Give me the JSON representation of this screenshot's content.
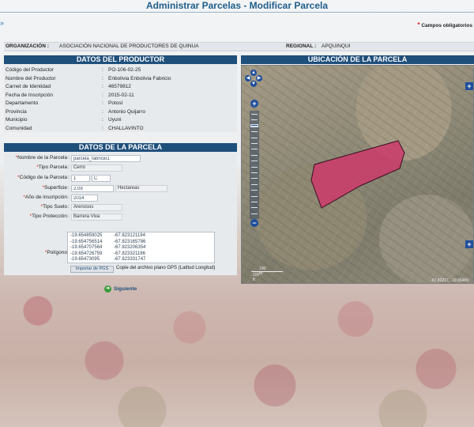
{
  "header": {
    "title": "Administrar Parcelas - Modificar Parcela",
    "required_note": "Campos obligatorios",
    "required_star": "*"
  },
  "org_bar": {
    "org_label": "ORGANIZACIÓN :",
    "org_value": "ASOCIACIÓN NACIONAL DE PRODUCTORES DE QUINUA",
    "regional_label": "REGIONAL :",
    "regional_value": "APQUINQUI"
  },
  "productor": {
    "title": "DATOS DEL PRODUCTOR",
    "rows": [
      {
        "label": "Código del Productor",
        "value": "PO-106-02-25"
      },
      {
        "label": "Nombre del Productor",
        "value": "Enbolivia   Enbolivia   Fabricio"
      },
      {
        "label": "Carnet de Identidad",
        "value": "46579812"
      },
      {
        "label": "Fecha de Inscripción",
        "value": "2015-02-11"
      },
      {
        "label": "Departamento",
        "value": "Potosí"
      },
      {
        "label": "Provincia",
        "value": "Antonio Quijarro"
      },
      {
        "label": "Municipio",
        "value": "Uyuni"
      },
      {
        "label": "Comunidad",
        "value": "CHALLAVINTO"
      }
    ],
    "separator": ":"
  },
  "parcela": {
    "title": "DATOS DE LA PARCELA",
    "separator": ":",
    "nombre_label": "Nombre de la Parcela",
    "nombre_value": "parcela_fabricio1",
    "tipo_label": "Tipo Parcela",
    "tipo_value": "Cerro",
    "codigo_label": "Código de la Parcela",
    "codigo_num": "1",
    "codigo_letter": "C",
    "superficie_label": "Superficie",
    "superficie_value": "2.09",
    "superficie_unit": "Hectareas",
    "anio_label": "Año de inscripción",
    "anio_value": "2014",
    "suelo_label": "Tipo Suelo",
    "suelo_value": "Arenosos",
    "proteccion_label": "Tipo Protección",
    "proteccion_value": "Barrera Viva",
    "poligono_label": "Polígono",
    "poligono_points": [
      {
        "lat": "-19.654859025",
        "lng": "-67.823121194"
      },
      {
        "lat": "-19.654756514",
        "lng": "-67.823165786"
      },
      {
        "lat": "-19.654707564",
        "lng": "-67.823206354"
      },
      {
        "lat": "-19.654726759",
        "lng": "-67.823321186"
      },
      {
        "lat": "-19.65473095",
        "lng": "-67.823331747"
      }
    ],
    "import_button": "Importar de PGS",
    "import_hint": "Copie del archivo plano GPS (Latitud Longitud)"
  },
  "map": {
    "title": "UBICACIÓN DE LA PARCELA",
    "scale_top": "100 m",
    "scale_bottom": "200 ft",
    "coords": "-67.82217, -19.65489",
    "zoom_in": "+",
    "zoom_out": "−",
    "layer_toggle": "+",
    "parcel_color": "#cc3a6a"
  },
  "actions": {
    "next_label": "Siguiente"
  },
  "colors": {
    "header_blue": "#1f4f7b",
    "title_blue": "#1f5e8a",
    "required_red": "#e02020"
  }
}
